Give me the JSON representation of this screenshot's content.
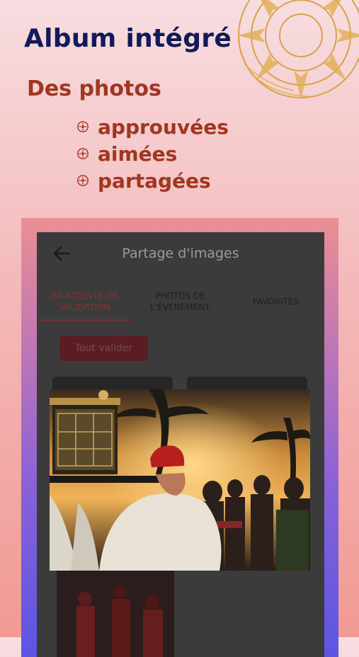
{
  "promo": {
    "headline": "Album intégré",
    "subhead": "Des photos",
    "features": [
      "approuvées",
      "aimées",
      "partagées"
    ]
  },
  "app": {
    "title": "Partage d'images",
    "tabs": [
      {
        "label": "EN ATTENTE DE VALIDATION",
        "active": true
      },
      {
        "label": "PHOTOS DE L'ÉVÉNEMENT",
        "active": false
      },
      {
        "label": "FAVORITES",
        "active": false
      }
    ],
    "validate_all_label": "Tout valider",
    "back_icon": "arrow-left-icon"
  },
  "colors": {
    "headline": "#111a5a",
    "accent": "#a6341f",
    "screen_bg": "#3b3b3b",
    "active_tab": "#8a2e36"
  }
}
